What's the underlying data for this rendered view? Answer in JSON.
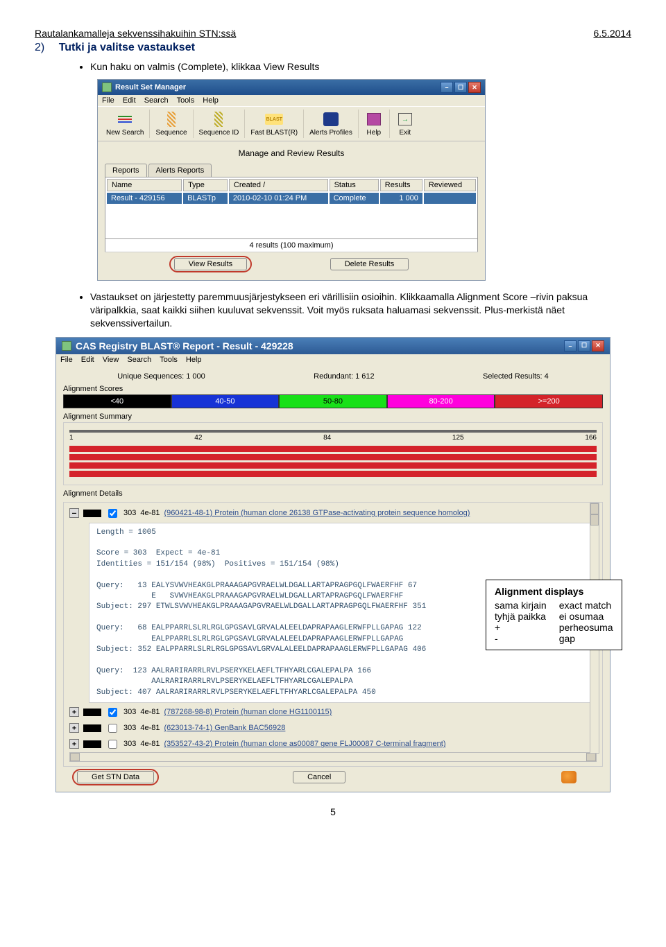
{
  "page_header": {
    "left": "Rautalankamalleja sekvenssihakuihin STN:ssä",
    "right": "6.5.2014"
  },
  "section": {
    "num": "2)",
    "title": "Tutki ja valitse vastaukset"
  },
  "bullet1": "Kun haku on valmis (Complete), klikkaa View Results",
  "rsm": {
    "title": "Result Set Manager",
    "menus": [
      "File",
      "Edit",
      "Search",
      "Tools",
      "Help"
    ],
    "toolbar": [
      {
        "label": "New Search"
      },
      {
        "label": "Sequence"
      },
      {
        "label": "Sequence ID"
      },
      {
        "label": "Fast BLAST(R)"
      },
      {
        "label": "Alerts Profiles"
      },
      {
        "label": "Help"
      },
      {
        "label": "Exit"
      }
    ],
    "panel_title": "Manage and Review Results",
    "tabs": [
      "Reports",
      "Alerts Reports"
    ],
    "columns": [
      "Name",
      "Type",
      "Created  /",
      "Status",
      "Results",
      "Reviewed"
    ],
    "row": {
      "name": "Result - 429156",
      "type": "BLASTp",
      "created": "2010-02-10  01:24 PM",
      "status": "Complete",
      "results": "1 000",
      "reviewed": ""
    },
    "meta": "4 results (100 maximum)",
    "buttons": {
      "view": "View Results",
      "delete": "Delete Results"
    }
  },
  "bullet2": "Vastaukset on järjestetty paremmuusjärjestykseen eri värillisiin osioihin. Klikkaamalla Alignment Score –rivin paksua väripalkkia, saat kaikki siihen kuuluvat sekvenssit. Voit myös ruksata haluamasi sekvenssit. Plus-merkistä näet sekvenssivertailun.",
  "blast": {
    "title": "CAS Registry BLAST® Report - Result - 429228",
    "menus": [
      "File",
      "Edit",
      "View",
      "Search",
      "Tools",
      "Help"
    ],
    "stats": {
      "unique": "Unique Sequences: 1 000",
      "redundant": "Redundant: 1 612",
      "selected": "Selected Results: 4"
    },
    "scores_label": "Alignment Scores",
    "scores": [
      {
        "label": "<40",
        "bg": "#000000"
      },
      {
        "label": "40-50",
        "bg": "#1733d6"
      },
      {
        "label": "50-80",
        "bg": "#18e018"
      },
      {
        "label": "80-200",
        "bg": "#ff00dd"
      },
      {
        "label": ">=200",
        "bg": "#d4232a"
      }
    ],
    "summary_label": "Alignment Summary",
    "axis": [
      "1",
      "42",
      "84",
      "125",
      "166"
    ],
    "details_label": "Alignment Details",
    "top_entry": {
      "score": "303",
      "evalue": "4e-81",
      "desc": "(960421-48-1) Protein (human clone 26138 GTPase-activating protein sequence homolog)",
      "checked": true,
      "expanded": true,
      "seq_text": "Length = 1005\n\nScore = 303  Expect = 4e-81\nIdentities = 151/154 (98%)  Positives = 151/154 (98%)\n\nQuery:   13 EALYSVWVHEAKGLPRAAAGAPGVRAELWLDGALLARTAPRAGPGQLFWAERFHF 67\n            E   SVWVHEAKGLPRAAAGAPGVRAELWLDGALLARTAPRAGPGQLFWAERFHF\nSubject: 297 ETWLSVWVHEAKGLPRAAAGAPGVRAELWLDGALLARTAPRAGPGQLFWAERFHF 351\n\nQuery:   68 EALPPARRLSLRLRGLGPGSAVLGRVALALEELDAPRAPAAGLERWFPLLGAPAG 122\n            EALPPARRLSLRLRGLGPGSAVLGRVALALEELDAPRAPAAGLERWFPLLGAPAG\nSubject: 352 EALPPARRLSLRLRGLGPGSAVLGRVALALEELDAPRAPAAGLERWFPLLGAPAG 406\n\nQuery:  123 AALRARIRARRLRVLPSERYKELAEFLTFHYARLCGALEPALPA 166\n            AALRARIRARRLRVLPSERYKELAEFLTFHYARLCGALEPALPA\nSubject: 407 AALRARIRARRLRVLPSERYKELAEFLTFHYARLCGALEPALPA 450"
    },
    "other_entries": [
      {
        "score": "303",
        "evalue": "4e-81",
        "desc": "(787268-98-8) Protein (human clone HG1100115)",
        "checked": true
      },
      {
        "score": "303",
        "evalue": "4e-81",
        "desc": "(623013-74-1) GenBank BAC56928",
        "checked": false
      },
      {
        "score": "303",
        "evalue": "4e-81",
        "desc": "(353527-43-2) Protein (human clone as00087 gene FLJ00087 C-terminal fragment)",
        "checked": false
      }
    ],
    "buttons": {
      "get": "Get STN Data",
      "cancel": "Cancel"
    }
  },
  "legend": {
    "title": "Alignment displays",
    "rows": [
      [
        "sama kirjain",
        "exact match"
      ],
      [
        "tyhjä paikka",
        "ei osumaa"
      ],
      [
        "+",
        "perheosuma"
      ],
      [
        "-",
        "gap"
      ]
    ]
  },
  "pagenum": "5"
}
